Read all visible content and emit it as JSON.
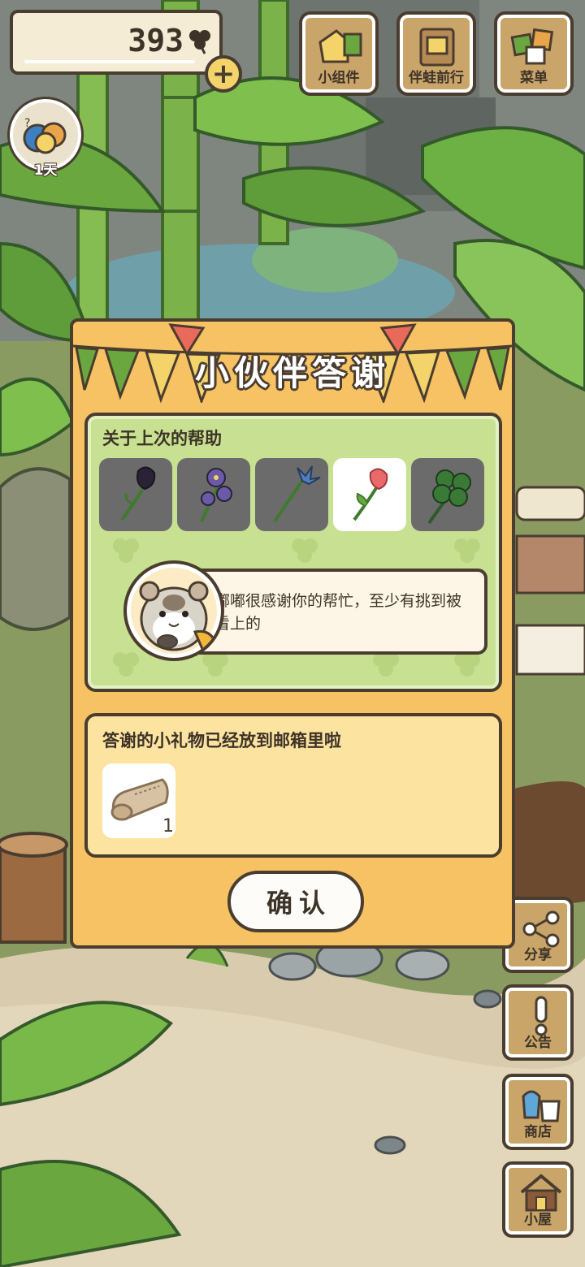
{
  "hud": {
    "clover_count": "393",
    "add_symbol": "+",
    "visitor_day_label": "1天"
  },
  "top_menu": [
    {
      "label": "小组件",
      "icon": "widget-icon"
    },
    {
      "label": "伴蛙前行",
      "icon": "journal-icon"
    },
    {
      "label": "菜单",
      "icon": "menu-cards-icon"
    }
  ],
  "side_menu": [
    {
      "label": "分享",
      "icon": "share-icon"
    },
    {
      "label": "公告",
      "icon": "exclamation-icon"
    },
    {
      "label": "商店",
      "icon": "shop-bags-icon"
    },
    {
      "label": "小屋",
      "icon": "house-icon"
    }
  ],
  "dialog": {
    "title": "小伙伴答谢",
    "help_heading": "关于上次的帮助",
    "flowers": [
      {
        "name": "black-tulip",
        "selected": false
      },
      {
        "name": "pansy",
        "selected": false
      },
      {
        "name": "blue-lily",
        "selected": false
      },
      {
        "name": "red-tulip",
        "selected": true
      },
      {
        "name": "four-leaf-clover",
        "selected": false
      }
    ],
    "message": "嘟嘟很感谢你的帮忙，至少有挑到被看上的",
    "gift_heading": "答谢的小礼物已经放到邮箱里啦",
    "gift": {
      "icon": "cloth-icon",
      "quantity": "1"
    },
    "confirm_label": "确认"
  },
  "colors": {
    "dialog_bg": "#f6c263",
    "help_panel_bg": "#c8e091",
    "gift_panel_bg": "#fde3a0",
    "outline": "#4a3d30",
    "button_wood": "#c9a56a"
  }
}
